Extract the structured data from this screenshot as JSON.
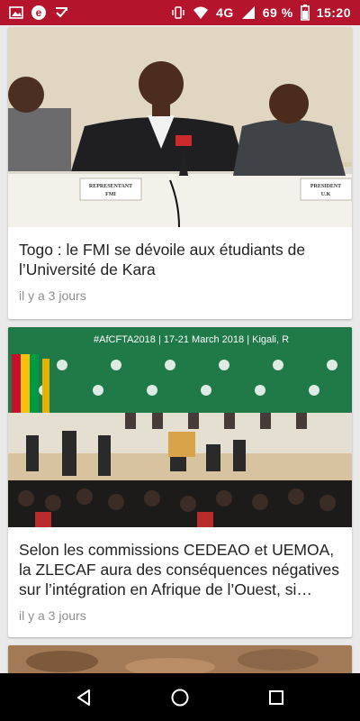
{
  "status_bar": {
    "network": "4G",
    "battery": "69 %",
    "time": "15:20",
    "color": "#b5142d",
    "icons_left": [
      "image-icon",
      "e-app-icon",
      "checkmark-app-icon"
    ],
    "icons_right": [
      "vibrate-icon",
      "wifi-icon",
      "signal-icon",
      "battery-icon"
    ]
  },
  "articles": [
    {
      "title": "Togo : le FMI se dévoile aux étudiants de l’Université de Kara",
      "time": "il y a 3 jours",
      "placards": [
        "REPRESENTANT FMI",
        "PRESIDENT U.K"
      ]
    },
    {
      "title": "Selon les commissions CEDEAO et UEMOA, la ZLECAF aura des conséquences négatives sur l’intégration en Afrique de l’Ouest, si…",
      "time": "il y a 3 jours",
      "banner": "#AfCFTA2018 | 17-21 March 2018 | Kigali, R"
    }
  ],
  "nav": {
    "buttons": [
      "back-icon",
      "home-icon",
      "recents-icon"
    ]
  }
}
